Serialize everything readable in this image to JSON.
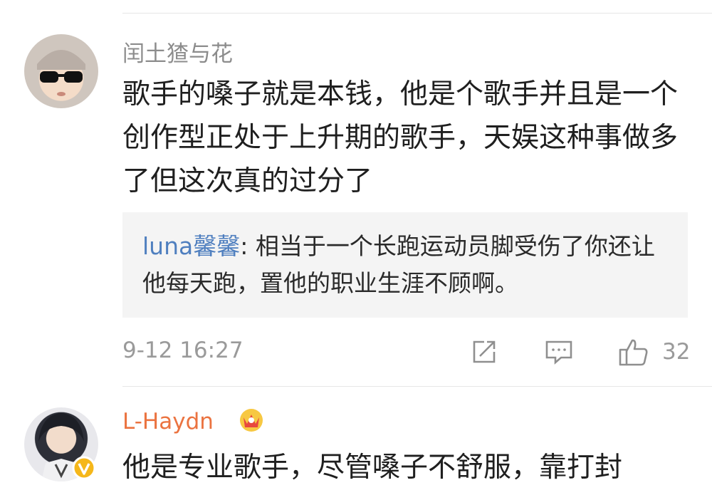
{
  "comments": [
    {
      "username": "闰土猹与花",
      "text": "歌手的嗓子就是本钱，他是个歌手并且是一个创作型正处于上升期的歌手，天娱这种事做多了但这次真的过分了",
      "reply": {
        "user": "luna馨馨",
        "separator": ": ",
        "text": "相当于一个长跑运动员脚受伤了你还让他每天跑，置他的职业生涯不顾啊。"
      },
      "timestamp": "9-12 16:27",
      "likes": "32",
      "icons": [
        "share-icon",
        "comment-icon",
        "thumbs-up-icon"
      ]
    },
    {
      "username": "L-Haydn",
      "badge": "crown-icon",
      "verified": "verified-v-icon",
      "text": "他是专业歌手，尽管嗓子不舒服，靠打封"
    }
  ],
  "colors": {
    "username_gray": "#8c8c8c",
    "reply_user_blue": "#4f7fbf",
    "vip_orange": "#eb7340",
    "reply_bg": "#f4f4f4"
  }
}
